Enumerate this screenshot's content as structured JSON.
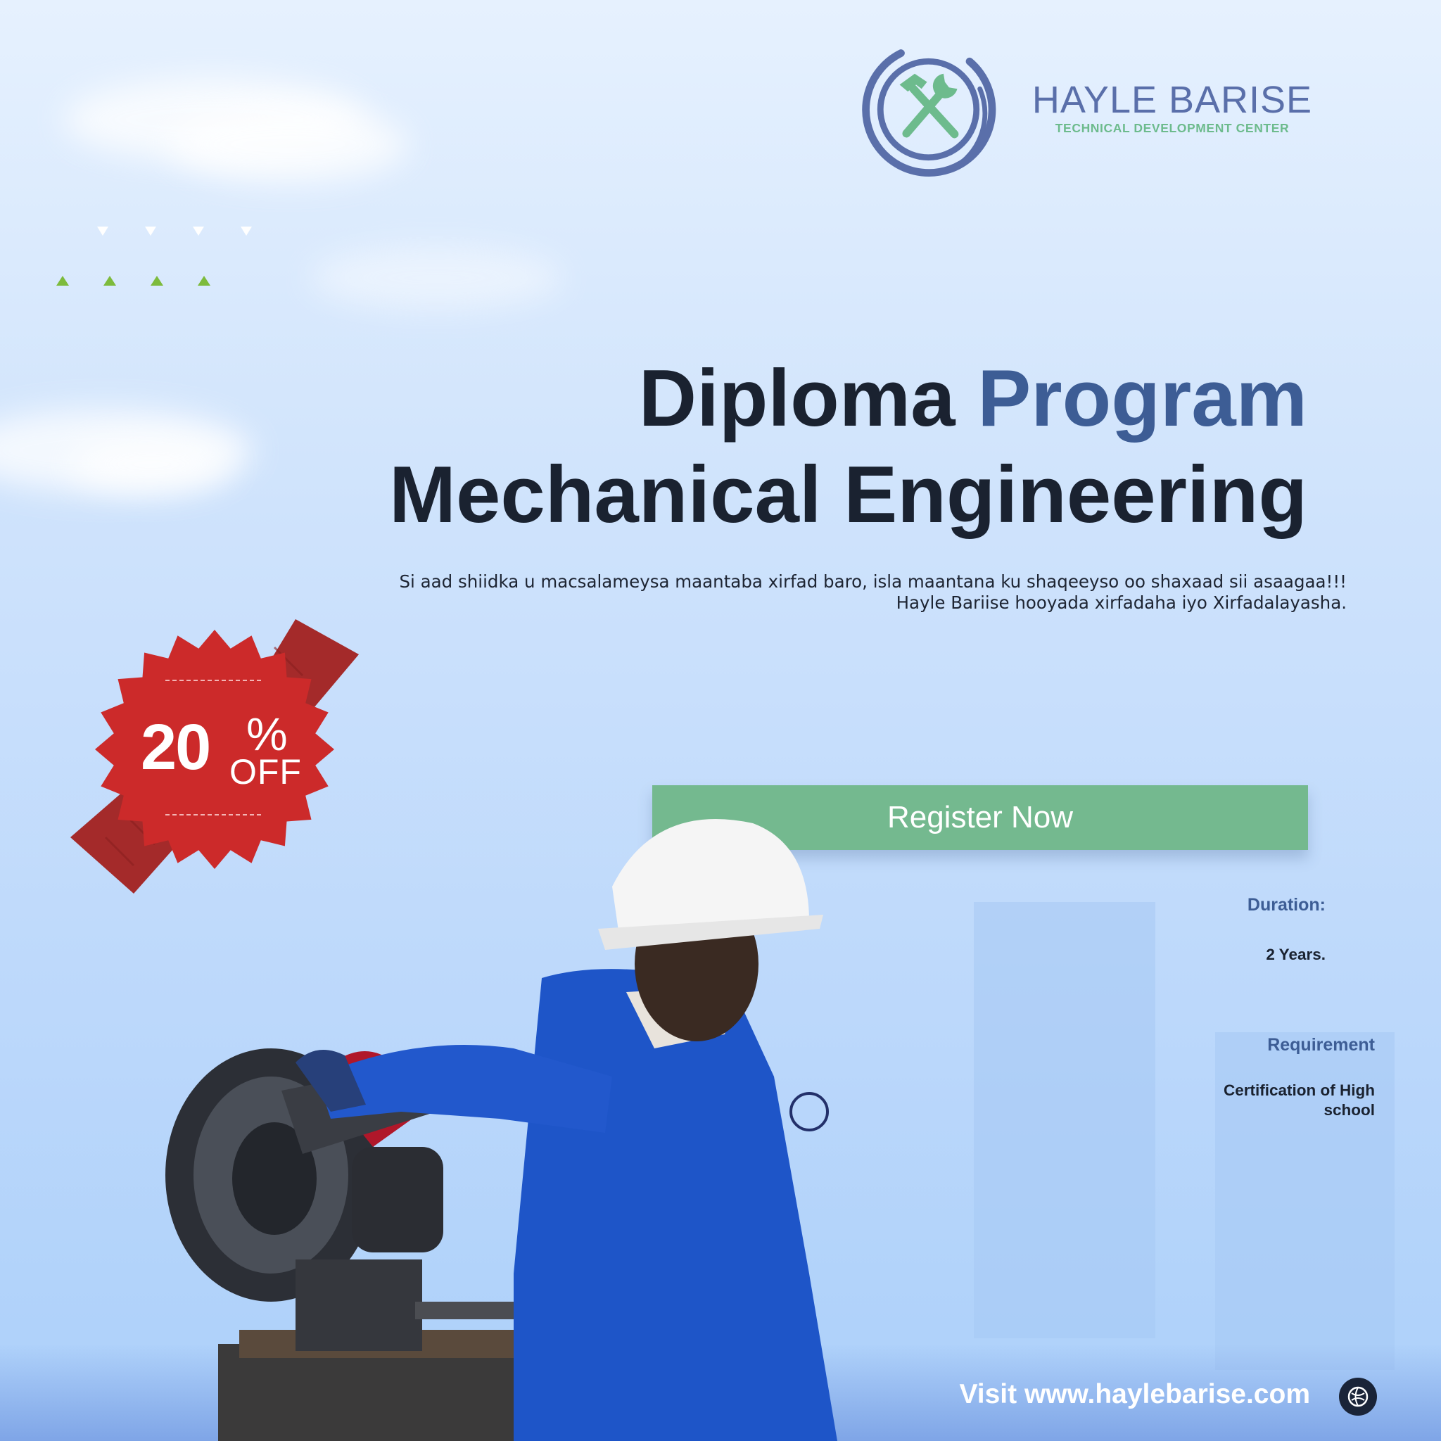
{
  "brand": {
    "name": "HAYLE BARISE",
    "subtitle": "TECHNICAL DEVELOPMENT CENTER",
    "icon": "hammer-wrench-icon",
    "colors": {
      "blue": "#5a6faa",
      "green": "#6dbb8d"
    }
  },
  "headline": {
    "word1": "Diploma",
    "word2": "Program",
    "line2": "Mechanical Engineering"
  },
  "tagline": {
    "line1": "Si aad shiidka u macsalameysa maantaba xirfad baro, isla maantana ku shaqeeyso oo shaxaad sii asaagaa!!!",
    "line2": "Hayle Bariise hooyada xirfadaha iyo Xirfadalayasha."
  },
  "badge": {
    "number": "20",
    "percent": "%",
    "off": "OFF",
    "color": "#cc2a2a"
  },
  "register": {
    "label": "Register Now",
    "color": "#74b98f"
  },
  "duration": {
    "label": "Duration:",
    "value": "2 Years."
  },
  "requirement": {
    "label": "Requirement",
    "value_line1": "Certification of High",
    "value_line2": "school"
  },
  "footer": {
    "visit": "Visit www.haylebarise.com",
    "icon": "globe-icon"
  }
}
